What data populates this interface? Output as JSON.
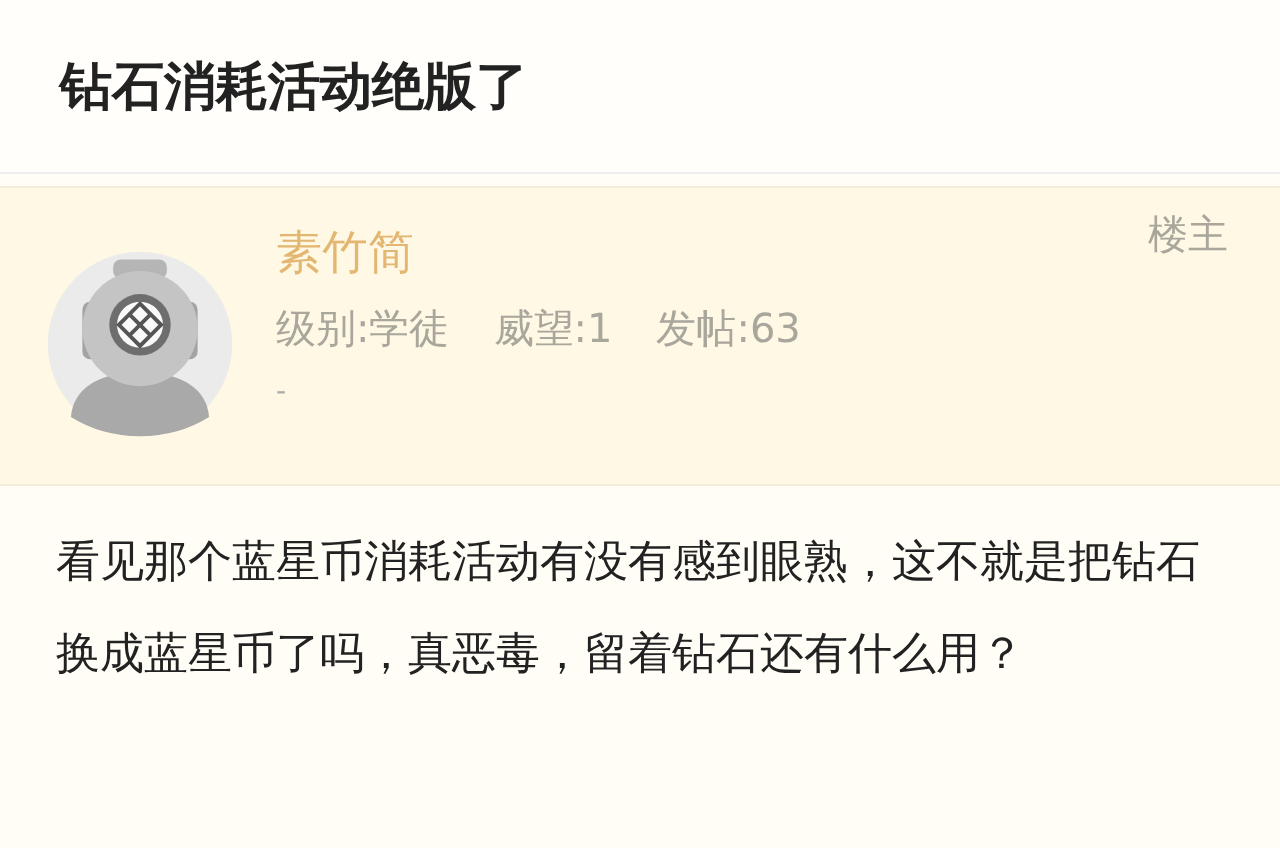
{
  "title": "钻石消耗活动绝版了",
  "post": {
    "author": "素竹简",
    "stats": [
      "级别:学徒",
      "威望:1",
      "发帖:63"
    ],
    "signature": "-",
    "badge": "楼主"
  },
  "body": "看见那个蓝星币消耗活动有没有感到眼熟，这不就是把钻石换成蓝星币了吗，真恶毒，留着钻石还有什么用？"
}
